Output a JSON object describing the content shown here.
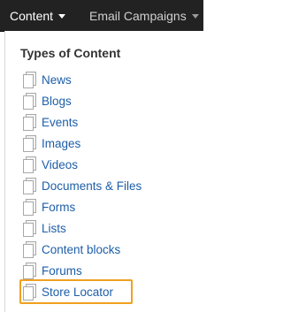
{
  "topbar": {
    "content_menu": "Content",
    "email_menu": "Email Campaigns"
  },
  "panel": {
    "heading": "Types of Content",
    "items": [
      {
        "label": "News"
      },
      {
        "label": "Blogs"
      },
      {
        "label": "Events"
      },
      {
        "label": "Images"
      },
      {
        "label": "Videos"
      },
      {
        "label": "Documents & Files"
      },
      {
        "label": "Forms"
      },
      {
        "label": "Lists"
      },
      {
        "label": "Content blocks"
      },
      {
        "label": "Forums"
      },
      {
        "label": "Store Locator",
        "highlighted": true
      }
    ]
  },
  "colors": {
    "topbar_bg": "#222222",
    "link": "#1d5ea8",
    "highlight_border": "#f0a020"
  },
  "icons": {
    "item_icon": "document-icon",
    "menu_caret": "caret-down-icon"
  }
}
